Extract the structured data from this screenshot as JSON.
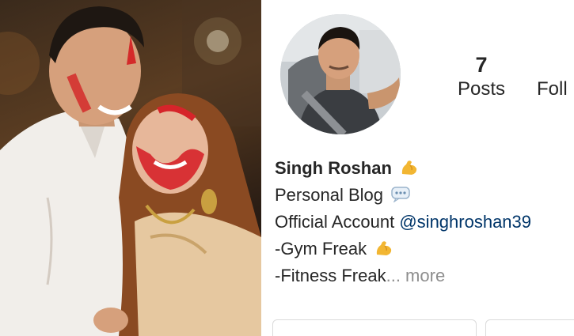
{
  "photo": {
    "description_icon": "photo-couple-icon"
  },
  "profile": {
    "avatar_icon": "profile-avatar-icon",
    "stats": {
      "posts_count": "7",
      "posts_label": "Posts",
      "followers_label": "Foll"
    },
    "bio": {
      "name": "Singh Roshan",
      "name_emoji": "flexed-biceps-icon",
      "line1": "Personal Blog",
      "line1_emoji": "speech-bubble-icon",
      "line2_prefix": "Official Account ",
      "line2_mention": "@singhroshan39",
      "line3": "-Gym Freak",
      "line3_emoji": "flexed-biceps-icon",
      "line4": "-Fitness Freak",
      "line4_ellipsis": "...",
      "line4_more": " more"
    },
    "colors": {
      "text": "#262626",
      "mention": "#003569",
      "muted": "#8e8e8e",
      "border": "#dbdbdb"
    }
  }
}
